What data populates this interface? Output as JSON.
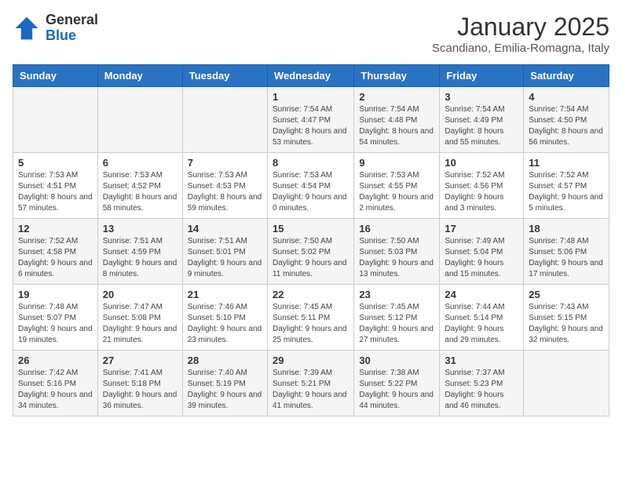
{
  "logo": {
    "general": "General",
    "blue": "Blue"
  },
  "header": {
    "title": "January 2025",
    "subtitle": "Scandiano, Emilia-Romagna, Italy"
  },
  "weekdays": [
    "Sunday",
    "Monday",
    "Tuesday",
    "Wednesday",
    "Thursday",
    "Friday",
    "Saturday"
  ],
  "weeks": [
    [
      {
        "day": "",
        "info": ""
      },
      {
        "day": "",
        "info": ""
      },
      {
        "day": "",
        "info": ""
      },
      {
        "day": "1",
        "info": "Sunrise: 7:54 AM\nSunset: 4:47 PM\nDaylight: 8 hours\nand 53 minutes."
      },
      {
        "day": "2",
        "info": "Sunrise: 7:54 AM\nSunset: 4:48 PM\nDaylight: 8 hours\nand 54 minutes."
      },
      {
        "day": "3",
        "info": "Sunrise: 7:54 AM\nSunset: 4:49 PM\nDaylight: 8 hours\nand 55 minutes."
      },
      {
        "day": "4",
        "info": "Sunrise: 7:54 AM\nSunset: 4:50 PM\nDaylight: 8 hours\nand 56 minutes."
      }
    ],
    [
      {
        "day": "5",
        "info": "Sunrise: 7:53 AM\nSunset: 4:51 PM\nDaylight: 8 hours\nand 57 minutes."
      },
      {
        "day": "6",
        "info": "Sunrise: 7:53 AM\nSunset: 4:52 PM\nDaylight: 8 hours\nand 58 minutes."
      },
      {
        "day": "7",
        "info": "Sunrise: 7:53 AM\nSunset: 4:53 PM\nDaylight: 8 hours\nand 59 minutes."
      },
      {
        "day": "8",
        "info": "Sunrise: 7:53 AM\nSunset: 4:54 PM\nDaylight: 9 hours\nand 0 minutes."
      },
      {
        "day": "9",
        "info": "Sunrise: 7:53 AM\nSunset: 4:55 PM\nDaylight: 9 hours\nand 2 minutes."
      },
      {
        "day": "10",
        "info": "Sunrise: 7:52 AM\nSunset: 4:56 PM\nDaylight: 9 hours\nand 3 minutes."
      },
      {
        "day": "11",
        "info": "Sunrise: 7:52 AM\nSunset: 4:57 PM\nDaylight: 9 hours\nand 5 minutes."
      }
    ],
    [
      {
        "day": "12",
        "info": "Sunrise: 7:52 AM\nSunset: 4:58 PM\nDaylight: 9 hours\nand 6 minutes."
      },
      {
        "day": "13",
        "info": "Sunrise: 7:51 AM\nSunset: 4:59 PM\nDaylight: 9 hours\nand 8 minutes."
      },
      {
        "day": "14",
        "info": "Sunrise: 7:51 AM\nSunset: 5:01 PM\nDaylight: 9 hours\nand 9 minutes."
      },
      {
        "day": "15",
        "info": "Sunrise: 7:50 AM\nSunset: 5:02 PM\nDaylight: 9 hours\nand 11 minutes."
      },
      {
        "day": "16",
        "info": "Sunrise: 7:50 AM\nSunset: 5:03 PM\nDaylight: 9 hours\nand 13 minutes."
      },
      {
        "day": "17",
        "info": "Sunrise: 7:49 AM\nSunset: 5:04 PM\nDaylight: 9 hours\nand 15 minutes."
      },
      {
        "day": "18",
        "info": "Sunrise: 7:48 AM\nSunset: 5:06 PM\nDaylight: 9 hours\nand 17 minutes."
      }
    ],
    [
      {
        "day": "19",
        "info": "Sunrise: 7:48 AM\nSunset: 5:07 PM\nDaylight: 9 hours\nand 19 minutes."
      },
      {
        "day": "20",
        "info": "Sunrise: 7:47 AM\nSunset: 5:08 PM\nDaylight: 9 hours\nand 21 minutes."
      },
      {
        "day": "21",
        "info": "Sunrise: 7:46 AM\nSunset: 5:10 PM\nDaylight: 9 hours\nand 23 minutes."
      },
      {
        "day": "22",
        "info": "Sunrise: 7:45 AM\nSunset: 5:11 PM\nDaylight: 9 hours\nand 25 minutes."
      },
      {
        "day": "23",
        "info": "Sunrise: 7:45 AM\nSunset: 5:12 PM\nDaylight: 9 hours\nand 27 minutes."
      },
      {
        "day": "24",
        "info": "Sunrise: 7:44 AM\nSunset: 5:14 PM\nDaylight: 9 hours\nand 29 minutes."
      },
      {
        "day": "25",
        "info": "Sunrise: 7:43 AM\nSunset: 5:15 PM\nDaylight: 9 hours\nand 32 minutes."
      }
    ],
    [
      {
        "day": "26",
        "info": "Sunrise: 7:42 AM\nSunset: 5:16 PM\nDaylight: 9 hours\nand 34 minutes."
      },
      {
        "day": "27",
        "info": "Sunrise: 7:41 AM\nSunset: 5:18 PM\nDaylight: 9 hours\nand 36 minutes."
      },
      {
        "day": "28",
        "info": "Sunrise: 7:40 AM\nSunset: 5:19 PM\nDaylight: 9 hours\nand 39 minutes."
      },
      {
        "day": "29",
        "info": "Sunrise: 7:39 AM\nSunset: 5:21 PM\nDaylight: 9 hours\nand 41 minutes."
      },
      {
        "day": "30",
        "info": "Sunrise: 7:38 AM\nSunset: 5:22 PM\nDaylight: 9 hours\nand 44 minutes."
      },
      {
        "day": "31",
        "info": "Sunrise: 7:37 AM\nSunset: 5:23 PM\nDaylight: 9 hours\nand 46 minutes."
      },
      {
        "day": "",
        "info": ""
      }
    ]
  ]
}
